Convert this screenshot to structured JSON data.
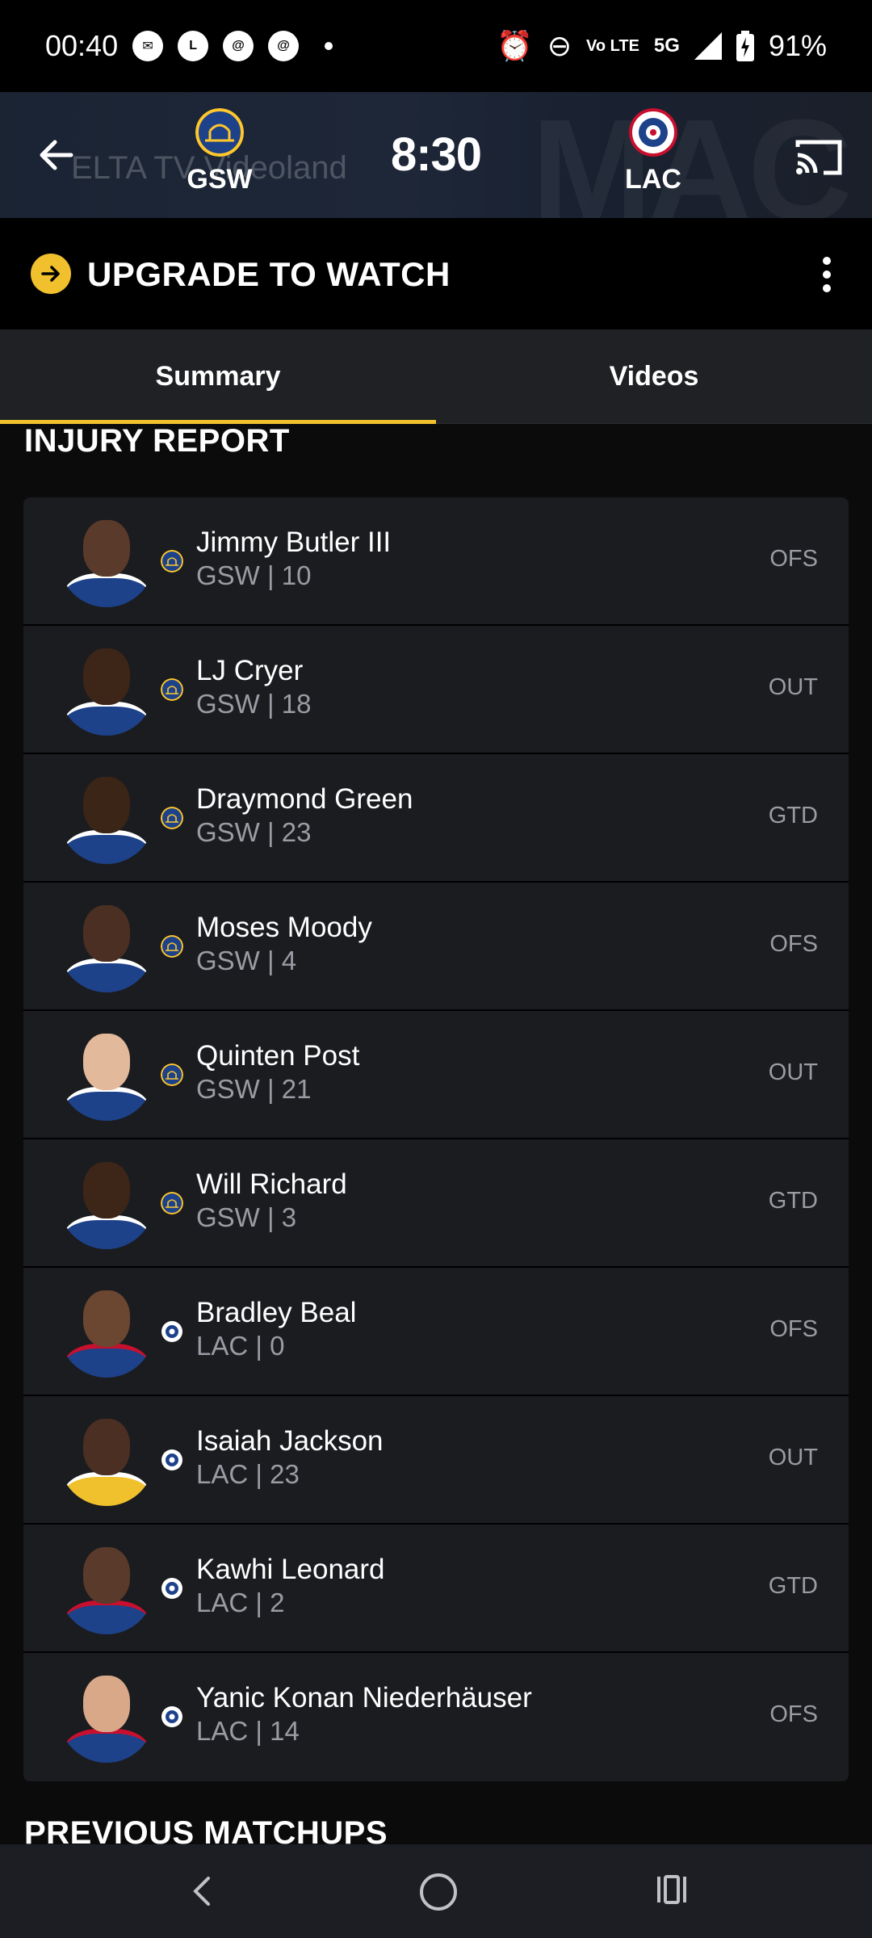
{
  "status_bar": {
    "time": "00:40",
    "battery": "91%",
    "network": "5G",
    "volte": "Vo LTE"
  },
  "game_header": {
    "watermark": "ELTA TV Videoland",
    "home_team": {
      "abbr": "GSW",
      "logo_color": "#1d428a",
      "accent": "#ffc72c"
    },
    "away_team": {
      "abbr": "LAC",
      "logo_color": "#c8102e",
      "accent": "#1d428a"
    },
    "clock": "8:30"
  },
  "upgrade": {
    "label": "UPGRADE TO WATCH",
    "accent": "#f0c02d"
  },
  "tabs": [
    {
      "label": "Summary",
      "active": true
    },
    {
      "label": "Videos",
      "active": false
    }
  ],
  "injury_report": {
    "title": "INJURY REPORT",
    "players": [
      {
        "name": "Jimmy Butler III",
        "meta": "GSW | 10",
        "status": "OFS",
        "team": "GSW"
      },
      {
        "name": "LJ Cryer",
        "meta": "GSW | 18",
        "status": "OUT",
        "team": "GSW"
      },
      {
        "name": "Draymond Green",
        "meta": "GSW | 23",
        "status": "GTD",
        "team": "GSW"
      },
      {
        "name": "Moses Moody",
        "meta": "GSW | 4",
        "status": "OFS",
        "team": "GSW"
      },
      {
        "name": "Quinten Post",
        "meta": "GSW | 21",
        "status": "OUT",
        "team": "GSW"
      },
      {
        "name": "Will Richard",
        "meta": "GSW | 3",
        "status": "GTD",
        "team": "GSW"
      },
      {
        "name": "Bradley Beal",
        "meta": "LAC | 0",
        "status": "OFS",
        "team": "LAC"
      },
      {
        "name": "Isaiah Jackson",
        "meta": "LAC | 23",
        "status": "OUT",
        "team": "LAC"
      },
      {
        "name": "Kawhi Leonard",
        "meta": "LAC | 2",
        "status": "GTD",
        "team": "LAC"
      },
      {
        "name": "Yanic Konan Niederhäuser",
        "meta": "LAC | 14",
        "status": "OFS",
        "team": "LAC"
      }
    ]
  },
  "previous_matchups": {
    "title": "PREVIOUS MATCHUPS"
  }
}
